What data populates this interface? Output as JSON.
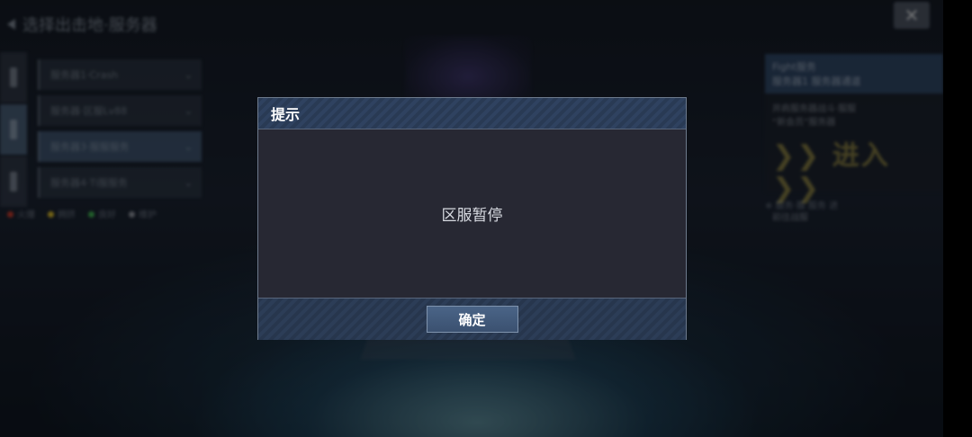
{
  "background": {
    "title": "选择出击地·服务器",
    "close_label": "✕",
    "server_items": [
      "服务器1·Crash",
      "服务器·区服Lv88",
      "服务器3·服服服务",
      "服务器4·Ti服服务"
    ],
    "status_legend": [
      "火爆",
      "拥挤",
      "良好",
      "维护"
    ],
    "status_colors": [
      "#c0392b",
      "#d4b62a",
      "#3fae4f",
      "#8a8f99"
    ],
    "promo": {
      "head_line1": "Fight服务",
      "head_line2": "服务器1 服务器通道",
      "body_line": "并肩服务器战斗·服服",
      "sub_line": "“新会员”服务器",
      "enter_label": "进入",
      "body_line2": "前往战服",
      "footer": "※ 服务·服 服务 进"
    }
  },
  "dialog": {
    "title": "提示",
    "message": "区服暂停",
    "confirm_label": "确定"
  }
}
